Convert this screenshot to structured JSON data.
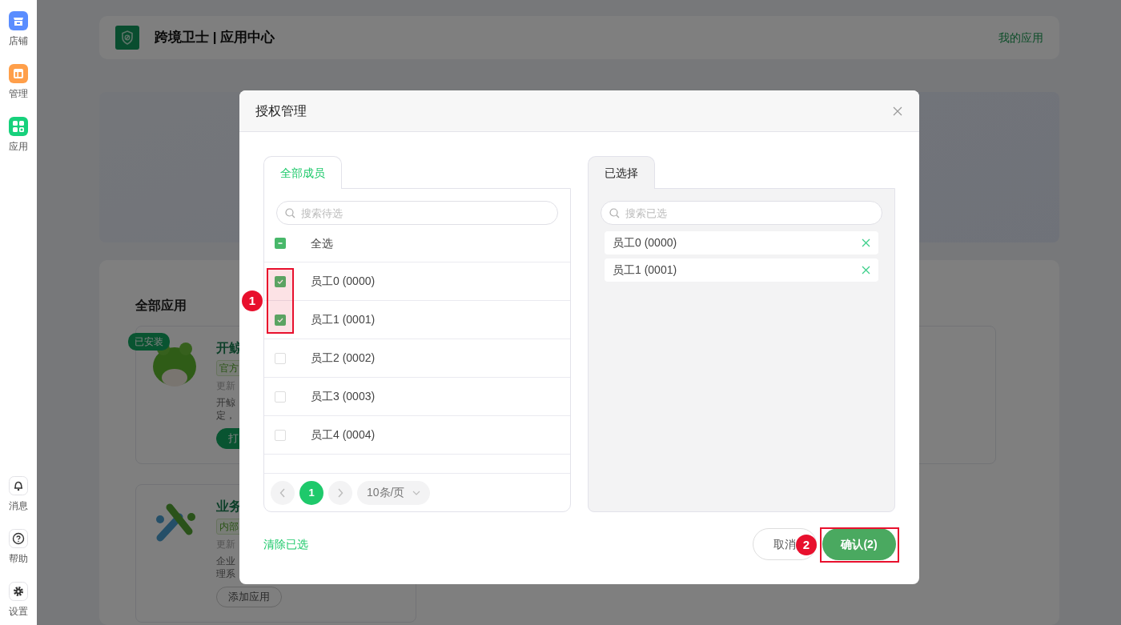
{
  "sidebar": {
    "top_items": [
      {
        "label": "店铺",
        "kind": "store",
        "color": "#5a8dff"
      },
      {
        "label": "管理",
        "kind": "layout",
        "color": "#ff9f4a"
      },
      {
        "label": "应用",
        "kind": "apps",
        "color": "#17d17c"
      }
    ],
    "bottom_items": [
      {
        "label": "消息",
        "kind": "bell"
      },
      {
        "label": "帮助",
        "kind": "help"
      },
      {
        "label": "设置",
        "kind": "gear"
      }
    ]
  },
  "header": {
    "title": "跨境卫士 | 应用中心",
    "link": "我的应用"
  },
  "apps_section": {
    "title": "全部应用",
    "apps": [
      {
        "kind": "mascot",
        "badge": "已安装",
        "name": "开鲸",
        "tag": "官方",
        "meta": "更新",
        "description": [
          "开鲸",
          "定，"
        ],
        "button": {
          "label": "打",
          "primary": true
        }
      },
      {
        "kind": "cross",
        "name": "业务",
        "tag": "内部",
        "meta": "更新",
        "description": [
          "企业",
          "理系"
        ],
        "button": {
          "label": "添加应用",
          "primary": false
        }
      }
    ]
  },
  "modal": {
    "title": "授权管理",
    "members": {
      "tab": "全部成员",
      "search_placeholder": "搜索待选",
      "select_all": {
        "label": "全选",
        "indeterminate": true
      },
      "items": [
        {
          "label": "员工0 (0000)",
          "checked": true
        },
        {
          "label": "员工1 (0001)",
          "checked": true
        },
        {
          "label": "员工2 (0002)",
          "checked": false
        },
        {
          "label": "员工3 (0003)",
          "checked": false
        },
        {
          "label": "员工4 (0004)",
          "checked": false
        }
      ],
      "pagination": {
        "pages": [
          {
            "label": "1",
            "selected": true
          }
        ],
        "page_size": "10条/页"
      }
    },
    "selected": {
      "tab": "已选择",
      "search_placeholder": "搜索已选",
      "items": [
        {
          "label": "员工0 (0000)"
        },
        {
          "label": "员工1 (0001)"
        }
      ]
    },
    "clear_link": "清除已选",
    "cancel": "取消",
    "confirm": "确认(2)"
  },
  "annotations": [
    {
      "label": "1"
    },
    {
      "label": "2"
    }
  ]
}
